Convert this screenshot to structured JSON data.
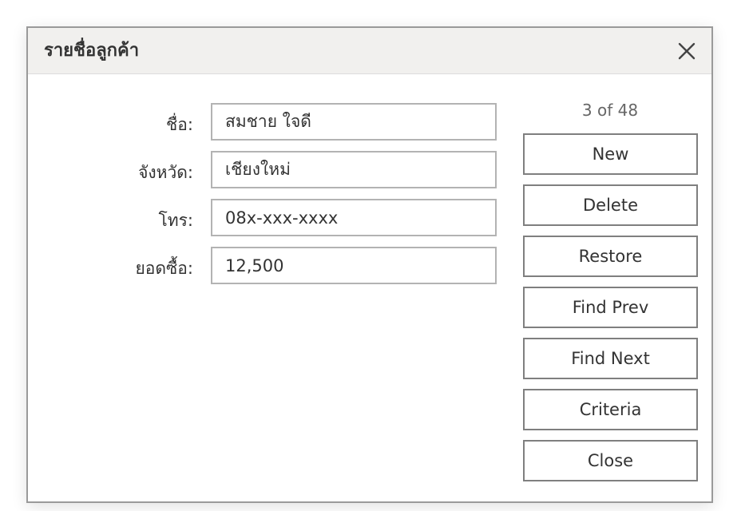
{
  "dialog": {
    "title": "รายชื่อลูกค้า",
    "close_icon": "close-icon"
  },
  "form": {
    "fields": [
      {
        "label": "ชื่อ:",
        "value": "สมชาย ใจดี"
      },
      {
        "label": "จังหวัด:",
        "value": "เชียงใหม่"
      },
      {
        "label": "โทร:",
        "value": "08x-xxx-xxxx"
      },
      {
        "label": "ยอดซื้อ:",
        "value": "12,500"
      }
    ]
  },
  "navigation": {
    "record_count": "3 of 48"
  },
  "buttons": {
    "new": "New",
    "delete": "Delete",
    "restore": "Restore",
    "find_prev": "Find Prev",
    "find_next": "Find Next",
    "criteria": "Criteria",
    "close": "Close"
  },
  "colors": {
    "titlebar_bg": "#f1f0ee",
    "border": "#9a9a9a",
    "text": "#333333"
  }
}
